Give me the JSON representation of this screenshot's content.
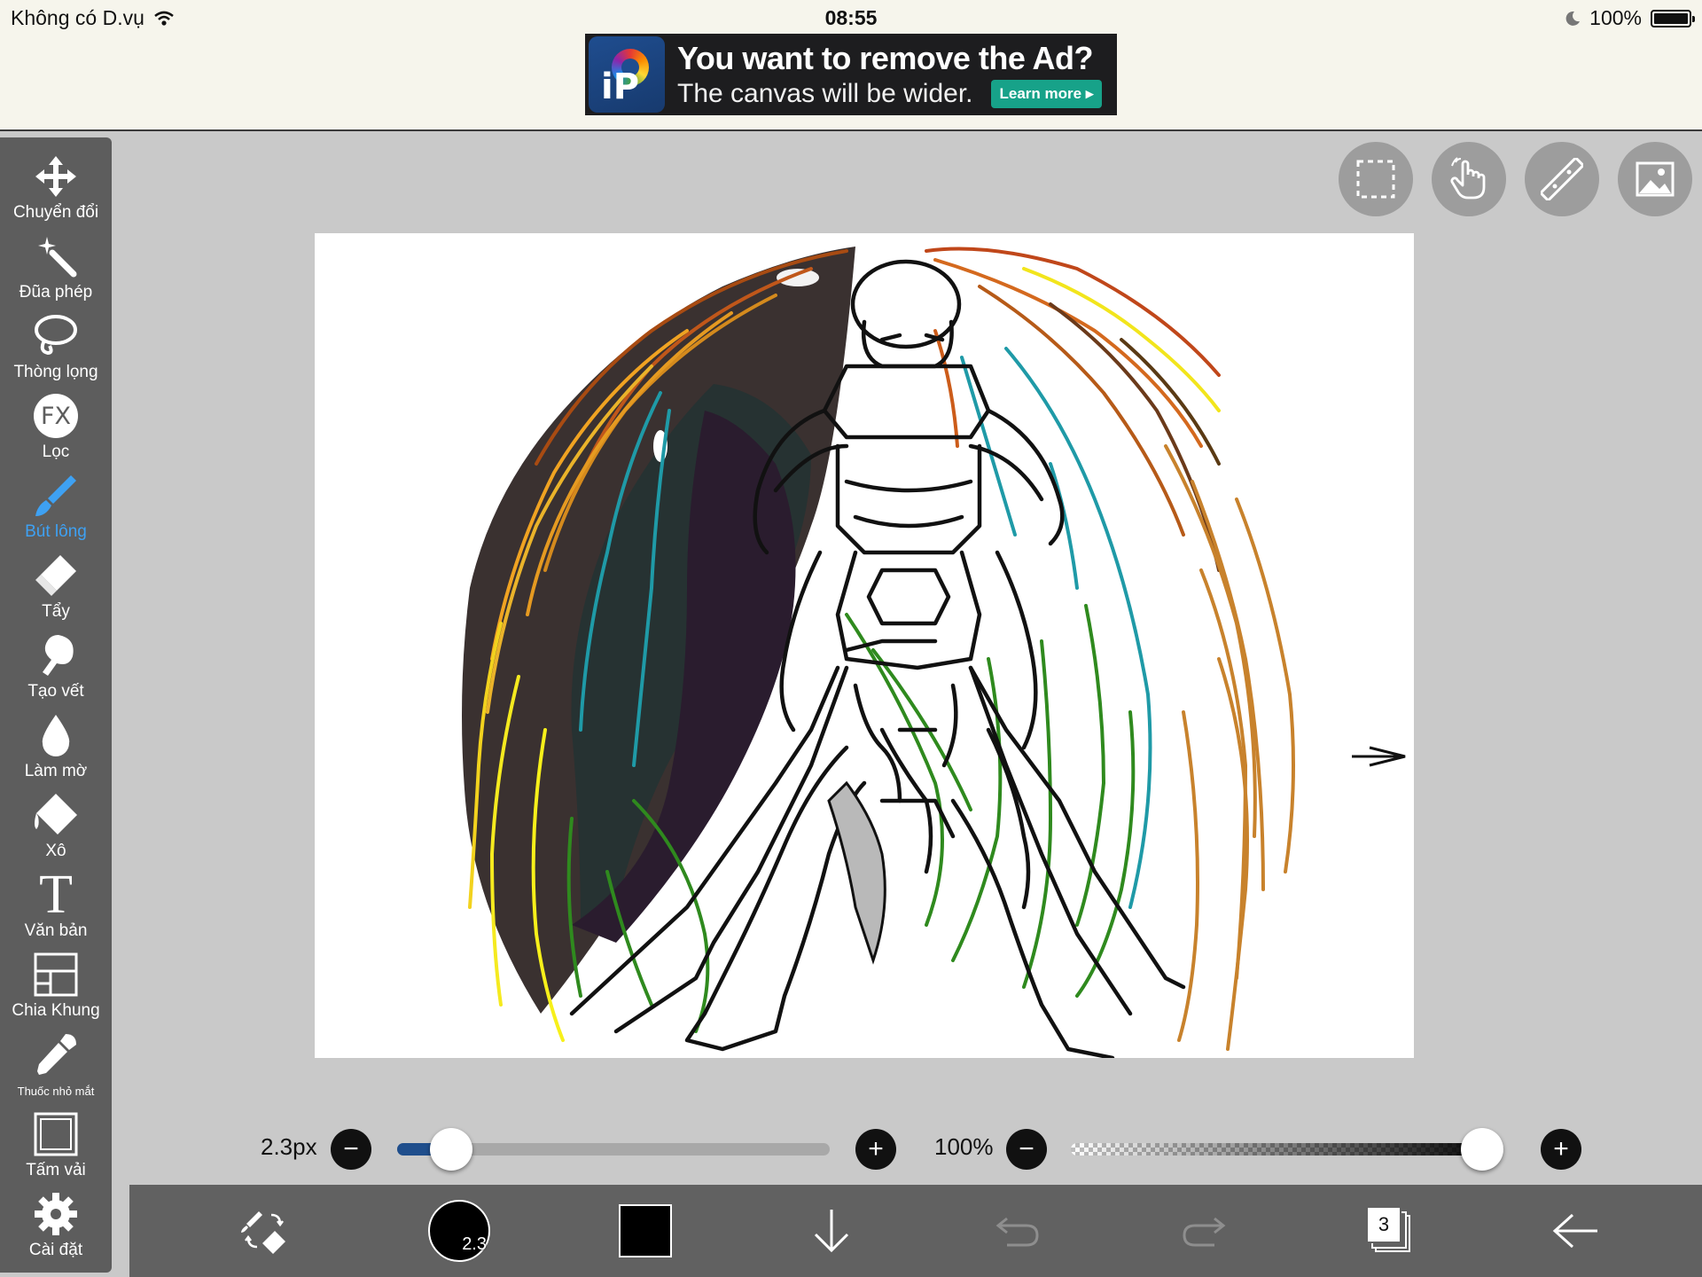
{
  "status_bar": {
    "carrier": "Không có D.vụ",
    "time": "08:55",
    "battery": "100%"
  },
  "ad": {
    "title": "You want to remove the Ad?",
    "subtitle": "The canvas will be wider.",
    "cta": "Learn more",
    "logo_text": "iP"
  },
  "tools": [
    {
      "label": "Chuyển đổi",
      "icon": "move-arrows-icon",
      "active": false
    },
    {
      "label": "Đũa phép",
      "icon": "magic-wand-icon",
      "active": false
    },
    {
      "label": "Thòng lọng",
      "icon": "lasso-icon",
      "active": false
    },
    {
      "label": "Lọc",
      "icon": "fx-icon",
      "icon_text": "FX",
      "active": false
    },
    {
      "label": "Bút lông",
      "icon": "brush-icon",
      "active": true
    },
    {
      "label": "Tẩy",
      "icon": "eraser-icon",
      "active": false
    },
    {
      "label": "Tạo vết",
      "icon": "smudge-icon",
      "active": false
    },
    {
      "label": "Làm mờ",
      "icon": "blur-drop-icon",
      "active": false
    },
    {
      "label": "Xô",
      "icon": "bucket-icon",
      "active": false
    },
    {
      "label": "Văn bản",
      "icon": "text-icon",
      "icon_text": "T",
      "active": false
    },
    {
      "label": "Chia Khung",
      "icon": "frame-divider-icon",
      "active": false
    },
    {
      "label": "Thuốc nhỏ mắt",
      "icon": "eyedropper-icon",
      "active": false
    },
    {
      "label": "Tấm vải",
      "icon": "canvas-icon",
      "active": false
    },
    {
      "label": "Cài đặt",
      "icon": "gear-icon",
      "active": false
    }
  ],
  "top_buttons": [
    "selection-icon",
    "hand-icon",
    "ruler-icon",
    "image-icon"
  ],
  "brush_size": {
    "label": "2.3px",
    "value": 2.3,
    "fraction": 0.1
  },
  "opacity": {
    "label": "100%",
    "value": 100,
    "fraction": 1.0
  },
  "bottom": {
    "brush_badge": "2.3",
    "color": "#000000",
    "layers_count": "3"
  },
  "colors": {
    "accent": "#3ea1f3",
    "toolbar": "#5d5d5d",
    "bottom_bar": "#616161"
  }
}
